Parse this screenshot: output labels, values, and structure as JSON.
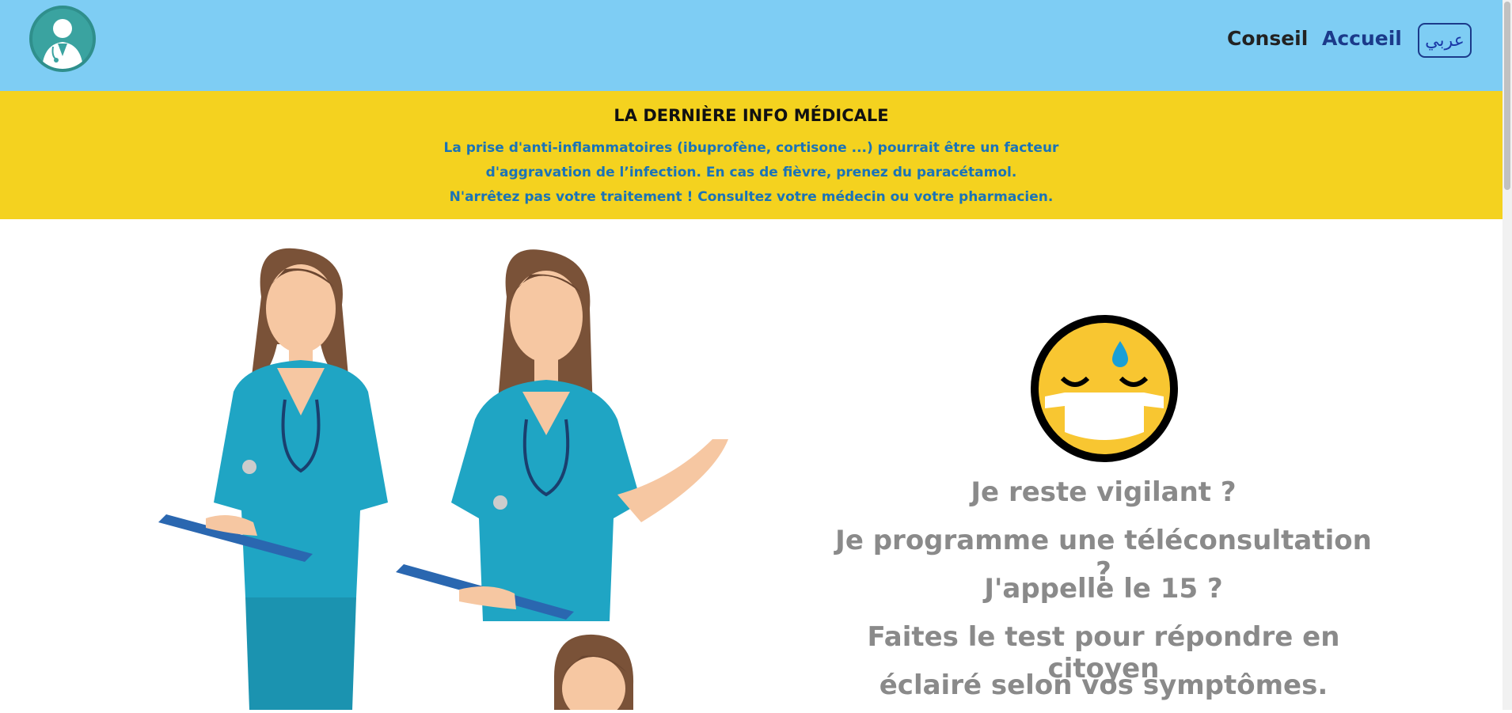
{
  "header": {
    "logo_icon": "doctor-avatar-icon",
    "nav": {
      "conseil": "Conseil",
      "accueil": "Accueil",
      "lang": "عربي"
    }
  },
  "banner": {
    "title": "LA DERNIÈRE INFO MÉDICALE",
    "line1": "La prise d'anti-inflammatoires (ibuprofène, cortisone ...) pourrait être un facteur",
    "line2": "d'aggravation de l’infection. En cas de fièvre, prenez du paracétamol.",
    "line3": "N'arrêtez pas votre traitement ! Consultez votre médecin ou votre pharmacien."
  },
  "main": {
    "illustration": "nurses-illustration",
    "emoji_icon": "sick-face-mask-emoji-icon",
    "questions": [
      "Je reste vigilant ?",
      "Je programme une téléconsultation ?",
      "J'appelle le 15 ?",
      "Faites le test pour répondre en citoyen",
      "éclairé selon vos symptômes."
    ]
  },
  "colors": {
    "header_bg": "#7ecdf4",
    "banner_bg": "#f4d21f",
    "banner_text": "#1a73b8",
    "question_text": "#8a8a8a",
    "scrubs": "#1fa5c4"
  }
}
